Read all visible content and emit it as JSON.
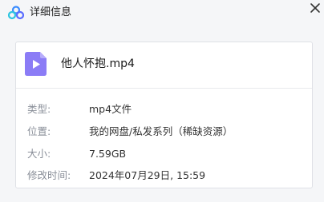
{
  "window": {
    "title": "详细信息",
    "logo_icon": "cloud-logo-icon",
    "close_icon": "close-icon"
  },
  "file": {
    "icon": "video-file-icon",
    "icon_color": "#8b7cf6",
    "name": "他人怀抱.mp4"
  },
  "details": [
    {
      "label": "类型:",
      "value": "mp4文件"
    },
    {
      "label": "位置:",
      "value": "我的网盘/私发系列（稀缺资源）"
    },
    {
      "label": "大小:",
      "value": "7.59GB"
    },
    {
      "label": "修改时间:",
      "value": "2024年07月29日, 15:59"
    }
  ]
}
